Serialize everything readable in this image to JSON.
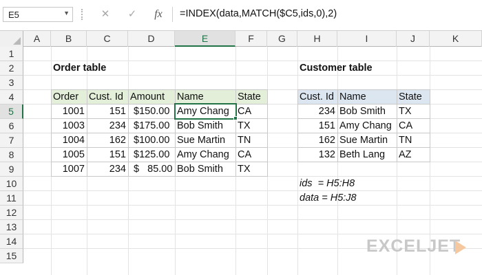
{
  "formula_bar": {
    "name_box": "E5",
    "cancel_glyph": "✕",
    "enter_glyph": "✓",
    "fx_glyph": "fx",
    "formula": "=INDEX(data,MATCH($C5,ids,0),2)"
  },
  "columns": [
    "A",
    "B",
    "C",
    "D",
    "E",
    "F",
    "G",
    "H",
    "I",
    "J",
    "K"
  ],
  "rows": [
    "1",
    "2",
    "3",
    "4",
    "5",
    "6",
    "7",
    "8",
    "9",
    "10",
    "11",
    "12",
    "13",
    "14",
    "15"
  ],
  "order_table": {
    "title": "Order table",
    "headers": [
      "Order",
      "Cust. Id",
      "Amount",
      "Name",
      "State"
    ],
    "rows": [
      [
        "1001",
        "151",
        "$150.00",
        "Amy Chang",
        "CA"
      ],
      [
        "1003",
        "234",
        "$175.00",
        "Bob Smith",
        "TX"
      ],
      [
        "1004",
        "162",
        "$100.00",
        "Sue Martin",
        "TN"
      ],
      [
        "1005",
        "151",
        "$125.00",
        "Amy Chang",
        "CA"
      ],
      [
        "1007",
        "234",
        "$   85.00",
        "Bob Smith",
        "TX"
      ]
    ]
  },
  "customer_table": {
    "title": "Customer table",
    "headers": [
      "Cust. Id",
      "Name",
      "State"
    ],
    "rows": [
      [
        "234",
        "Bob Smith",
        "TX"
      ],
      [
        "151",
        "Amy Chang",
        "CA"
      ],
      [
        "162",
        "Sue Martin",
        "TN"
      ],
      [
        "132",
        "Beth Lang",
        "AZ"
      ]
    ]
  },
  "named_ranges": {
    "ids": "ids  = H5:H8",
    "data": "data = H5:J8"
  },
  "logo": "EXCELJET",
  "colors": {
    "accent": "#217346",
    "order_header_bg": "#e3efd9",
    "customer_header_bg": "#dce6f1"
  }
}
